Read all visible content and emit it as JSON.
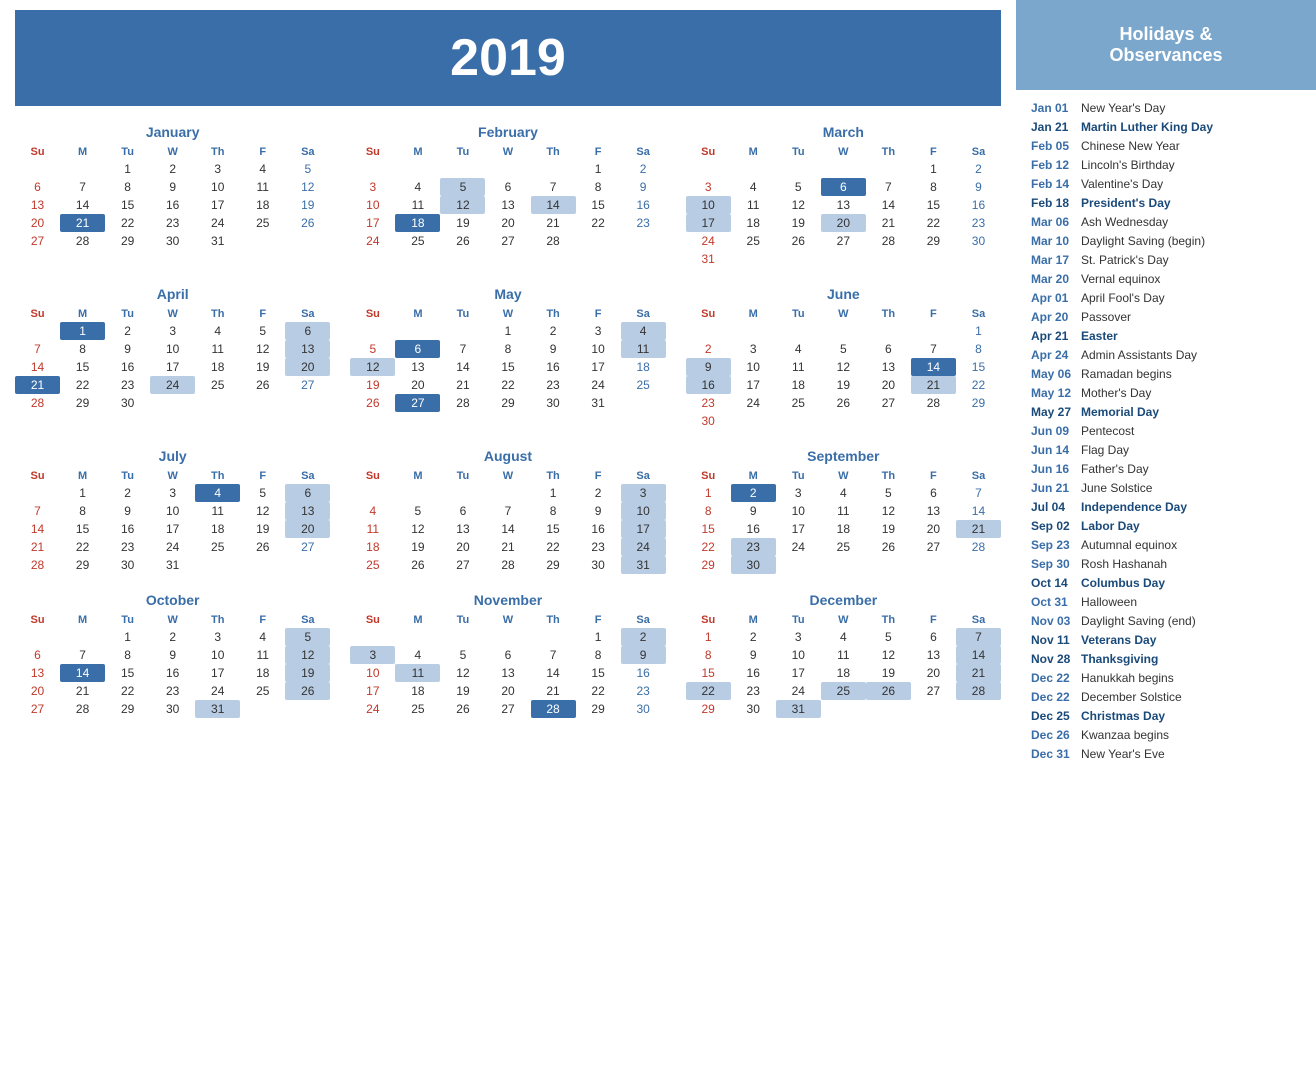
{
  "year": "2019",
  "months": [
    {
      "name": "January",
      "startDay": 2,
      "days": 31,
      "weeks": [
        [
          "",
          "",
          1,
          2,
          3,
          4,
          5
        ],
        [
          6,
          7,
          8,
          9,
          10,
          11,
          12
        ],
        [
          13,
          14,
          15,
          16,
          17,
          18,
          19
        ],
        [
          20,
          "21",
          22,
          23,
          24,
          25,
          26
        ],
        [
          27,
          28,
          29,
          30,
          31,
          "",
          ""
        ]
      ],
      "highlights": {
        "21": "holiday"
      },
      "bold": {
        "1": true
      }
    },
    {
      "name": "February",
      "startDay": 5,
      "days": 28,
      "weeks": [
        [
          "",
          "",
          "",
          "",
          "",
          1,
          2
        ],
        [
          3,
          4,
          "5",
          6,
          7,
          8,
          9
        ],
        [
          10,
          11,
          "12",
          13,
          "14",
          15,
          16
        ],
        [
          17,
          "18",
          19,
          20,
          21,
          22,
          23
        ],
        [
          24,
          25,
          26,
          27,
          28,
          "",
          ""
        ]
      ],
      "highlights": {
        "5": "highlighted",
        "12": "highlighted",
        "14": "highlighted",
        "18": "holiday"
      }
    },
    {
      "name": "March",
      "startDay": 5,
      "days": 31,
      "weeks": [
        [
          "",
          "",
          "",
          "",
          "",
          1,
          2
        ],
        [
          3,
          4,
          5,
          "6",
          7,
          8,
          9
        ],
        [
          "10",
          11,
          12,
          13,
          14,
          15,
          16
        ],
        [
          "17",
          18,
          19,
          "20",
          21,
          22,
          23
        ],
        [
          24,
          25,
          26,
          27,
          28,
          29,
          30
        ],
        [
          31,
          "",
          "",
          "",
          "",
          "",
          ""
        ]
      ],
      "highlights": {
        "6": "holiday",
        "10": "highlighted",
        "17": "highlighted",
        "20": "highlighted"
      }
    },
    {
      "name": "April",
      "startDay": 1,
      "days": 30,
      "weeks": [
        [
          "",
          1,
          2,
          3,
          4,
          5,
          "6"
        ],
        [
          7,
          8,
          9,
          10,
          11,
          12,
          "13"
        ],
        [
          14,
          15,
          16,
          17,
          18,
          19,
          "20"
        ],
        [
          "21",
          22,
          23,
          "24",
          25,
          26,
          27
        ],
        [
          28,
          29,
          30,
          "",
          "",
          "",
          ""
        ]
      ],
      "highlights": {
        "1": "holiday",
        "6": "highlighted",
        "13": "highlighted",
        "20": "highlighted",
        "21": "holiday",
        "24": "highlighted"
      }
    },
    {
      "name": "May",
      "startDay": 3,
      "days": 31,
      "weeks": [
        [
          "",
          "",
          "",
          1,
          2,
          3,
          "4"
        ],
        [
          5,
          "6",
          7,
          8,
          9,
          10,
          "11"
        ],
        [
          "12",
          13,
          14,
          15,
          16,
          17,
          18
        ],
        [
          19,
          20,
          21,
          22,
          23,
          24,
          25
        ],
        [
          26,
          "27",
          28,
          29,
          30,
          31,
          ""
        ]
      ],
      "highlights": {
        "4": "highlighted",
        "6": "holiday",
        "11": "highlighted",
        "12": "highlighted",
        "27": "holiday"
      }
    },
    {
      "name": "June",
      "startDay": 6,
      "days": 30,
      "weeks": [
        [
          "",
          "",
          "",
          "",
          "",
          "",
          1
        ],
        [
          2,
          3,
          4,
          5,
          6,
          7,
          8
        ],
        [
          "9",
          10,
          11,
          12,
          13,
          "14",
          15
        ],
        [
          "16",
          17,
          18,
          19,
          20,
          "21",
          22
        ],
        [
          23,
          24,
          25,
          26,
          27,
          28,
          29
        ],
        [
          30,
          "",
          "",
          "",
          "",
          "",
          ""
        ]
      ],
      "highlights": {
        "9": "highlighted",
        "14": "holiday",
        "16": "highlighted",
        "21": "highlighted"
      }
    },
    {
      "name": "July",
      "startDay": 1,
      "days": 31,
      "weeks": [
        [
          "",
          1,
          2,
          3,
          "4",
          5,
          "6"
        ],
        [
          7,
          8,
          9,
          10,
          11,
          12,
          "13"
        ],
        [
          14,
          15,
          16,
          17,
          18,
          19,
          "20"
        ],
        [
          21,
          22,
          23,
          24,
          25,
          26,
          27
        ],
        [
          28,
          29,
          30,
          31,
          "",
          "",
          ""
        ]
      ],
      "highlights": {
        "4": "holiday",
        "6": "highlighted",
        "13": "highlighted",
        "20": "highlighted"
      }
    },
    {
      "name": "August",
      "startDay": 4,
      "days": 31,
      "weeks": [
        [
          "",
          "",
          "",
          "",
          1,
          2,
          "3"
        ],
        [
          4,
          5,
          6,
          7,
          8,
          9,
          "10"
        ],
        [
          11,
          12,
          13,
          14,
          15,
          16,
          "17"
        ],
        [
          18,
          19,
          20,
          21,
          22,
          23,
          "24"
        ],
        [
          25,
          26,
          27,
          28,
          29,
          30,
          "31"
        ]
      ],
      "highlights": {
        "3": "highlighted",
        "10": "highlighted",
        "17": "highlighted",
        "24": "highlighted",
        "31": "highlighted"
      }
    },
    {
      "name": "September",
      "startDay": 0,
      "days": 30,
      "weeks": [
        [
          1,
          "2",
          3,
          4,
          5,
          6,
          7
        ],
        [
          8,
          9,
          10,
          11,
          12,
          13,
          14
        ],
        [
          15,
          16,
          17,
          18,
          19,
          20,
          "21"
        ],
        [
          22,
          "23",
          24,
          25,
          26,
          27,
          28
        ],
        [
          29,
          "30",
          "",
          "",
          "",
          "",
          ""
        ]
      ],
      "highlights": {
        "2": "holiday",
        "21": "highlighted",
        "23": "highlighted",
        "30": "highlighted"
      }
    },
    {
      "name": "October",
      "startDay": 2,
      "days": 31,
      "weeks": [
        [
          "",
          "",
          1,
          2,
          3,
          4,
          "5"
        ],
        [
          6,
          7,
          8,
          9,
          10,
          11,
          "12"
        ],
        [
          13,
          "14",
          15,
          16,
          17,
          18,
          "19"
        ],
        [
          20,
          21,
          22,
          23,
          24,
          25,
          "26"
        ],
        [
          27,
          28,
          29,
          30,
          "31",
          "",
          ""
        ]
      ],
      "highlights": {
        "5": "highlighted",
        "12": "highlighted",
        "14": "holiday",
        "19": "highlighted",
        "26": "highlighted",
        "31": "highlighted"
      }
    },
    {
      "name": "November",
      "startDay": 5,
      "days": 30,
      "weeks": [
        [
          "",
          "",
          "",
          "",
          "",
          1,
          "2"
        ],
        [
          "3",
          4,
          5,
          6,
          7,
          8,
          "9"
        ],
        [
          10,
          "11",
          12,
          13,
          14,
          15,
          16
        ],
        [
          17,
          18,
          19,
          20,
          21,
          22,
          23
        ],
        [
          24,
          25,
          26,
          27,
          "28",
          29,
          30
        ]
      ],
      "highlights": {
        "2": "highlighted",
        "3": "highlighted",
        "9": "highlighted",
        "11": "highlighted",
        "28": "holiday"
      }
    },
    {
      "name": "December",
      "startDay": 0,
      "days": 31,
      "weeks": [
        [
          1,
          2,
          3,
          4,
          5,
          6,
          "7"
        ],
        [
          8,
          9,
          10,
          11,
          12,
          13,
          "14"
        ],
        [
          15,
          16,
          17,
          18,
          19,
          20,
          "21"
        ],
        [
          "22",
          23,
          24,
          "25",
          "26",
          27,
          "28"
        ],
        [
          29,
          30,
          "31",
          "",
          "",
          "",
          ""
        ]
      ],
      "highlights": {
        "7": "highlighted",
        "14": "highlighted",
        "21": "highlighted",
        "22": "highlighted",
        "25": "highlighted",
        "26": "highlighted",
        "28": "highlighted",
        "31": "highlighted"
      }
    }
  ],
  "sidebar": {
    "header": "Holidays &\nObservances",
    "holidays": [
      {
        "date": "Jan 01",
        "name": "New Year's Day",
        "bold": false
      },
      {
        "date": "Jan 21",
        "name": "Martin Luther King Day",
        "bold": true
      },
      {
        "date": "Feb 05",
        "name": "Chinese New Year",
        "bold": false
      },
      {
        "date": "Feb 12",
        "name": "Lincoln's Birthday",
        "bold": false
      },
      {
        "date": "Feb 14",
        "name": "Valentine's Day",
        "bold": false
      },
      {
        "date": "Feb 18",
        "name": "President's Day",
        "bold": true
      },
      {
        "date": "Mar 06",
        "name": "Ash Wednesday",
        "bold": false
      },
      {
        "date": "Mar 10",
        "name": "Daylight Saving (begin)",
        "bold": false
      },
      {
        "date": "Mar 17",
        "name": "St. Patrick's Day",
        "bold": false
      },
      {
        "date": "Mar 20",
        "name": "Vernal equinox",
        "bold": false
      },
      {
        "date": "Apr 01",
        "name": "April Fool's Day",
        "bold": false
      },
      {
        "date": "Apr 20",
        "name": "Passover",
        "bold": false
      },
      {
        "date": "Apr 21",
        "name": "Easter",
        "bold": true
      },
      {
        "date": "Apr 24",
        "name": "Admin Assistants Day",
        "bold": false
      },
      {
        "date": "May 06",
        "name": "Ramadan begins",
        "bold": false
      },
      {
        "date": "May 12",
        "name": "Mother's Day",
        "bold": false
      },
      {
        "date": "May 27",
        "name": "Memorial Day",
        "bold": true
      },
      {
        "date": "Jun 09",
        "name": "Pentecost",
        "bold": false
      },
      {
        "date": "Jun 14",
        "name": "Flag Day",
        "bold": false
      },
      {
        "date": "Jun 16",
        "name": "Father's Day",
        "bold": false
      },
      {
        "date": "Jun 21",
        "name": "June Solstice",
        "bold": false
      },
      {
        "date": "Jul 04",
        "name": "Independence Day",
        "bold": true
      },
      {
        "date": "Sep 02",
        "name": "Labor Day",
        "bold": true
      },
      {
        "date": "Sep 23",
        "name": "Autumnal equinox",
        "bold": false
      },
      {
        "date": "Sep 30",
        "name": "Rosh Hashanah",
        "bold": false
      },
      {
        "date": "Oct 14",
        "name": "Columbus Day",
        "bold": true
      },
      {
        "date": "Oct 31",
        "name": "Halloween",
        "bold": false
      },
      {
        "date": "Nov 03",
        "name": "Daylight Saving (end)",
        "bold": false
      },
      {
        "date": "Nov 11",
        "name": "Veterans Day",
        "bold": true
      },
      {
        "date": "Nov 28",
        "name": "Thanksgiving",
        "bold": true
      },
      {
        "date": "Dec 22",
        "name": "Hanukkah begins",
        "bold": false
      },
      {
        "date": "Dec 22",
        "name": "December Solstice",
        "bold": false
      },
      {
        "date": "Dec 25",
        "name": "Christmas Day",
        "bold": true
      },
      {
        "date": "Dec 26",
        "name": "Kwanzaa begins",
        "bold": false
      },
      {
        "date": "Dec 31",
        "name": "New Year's Eve",
        "bold": false
      }
    ]
  }
}
